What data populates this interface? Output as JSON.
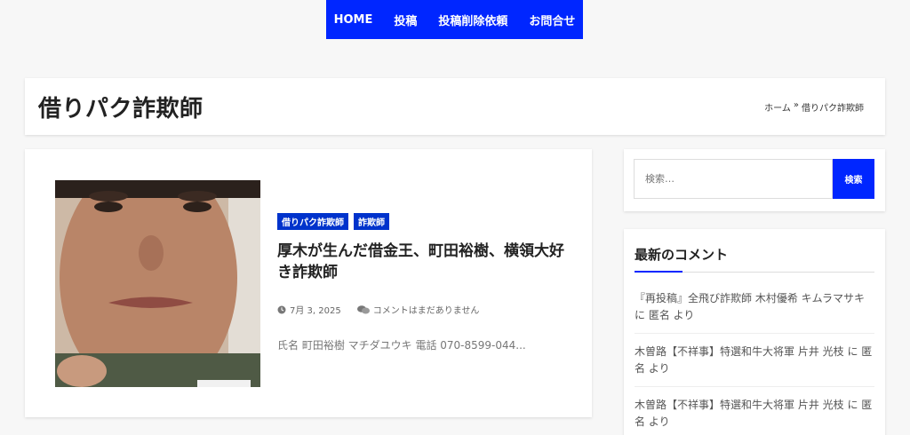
{
  "nav": {
    "items": [
      {
        "label": "HOME"
      },
      {
        "label": "投稿"
      },
      {
        "label": "投稿削除依頼"
      },
      {
        "label": "お問合せ"
      }
    ],
    "color": "#0026ff"
  },
  "page": {
    "title": "借りパク詐欺師"
  },
  "breadcrumb": {
    "home": "ホーム",
    "sep": "»",
    "current": "借りパク詐欺師"
  },
  "post": {
    "categories": [
      {
        "label": "借りパク詐欺師"
      },
      {
        "label": "詐欺師"
      }
    ],
    "title": "厚木が生んだ借金王、町田裕樹、横領大好き詐欺師",
    "date": "7月 3, 2025",
    "comments": "コメントはまだありません",
    "excerpt": "氏名 町田裕樹 マチダユウキ 電話 070-8599-044..."
  },
  "search": {
    "placeholder": "検索…",
    "button": "検索"
  },
  "recent_comments": {
    "title": "最新のコメント",
    "items": [
      {
        "text": "『再投稿』全飛び詐欺師 木村優希 キムラマサキ に 匿名 より"
      },
      {
        "text": "木曽路【不祥事】特選和牛大将軍 片井 光枝 に 匿名 より"
      },
      {
        "text": "木曽路【不祥事】特選和牛大将軍 片井 光枝 に 匿名 より"
      }
    ]
  }
}
